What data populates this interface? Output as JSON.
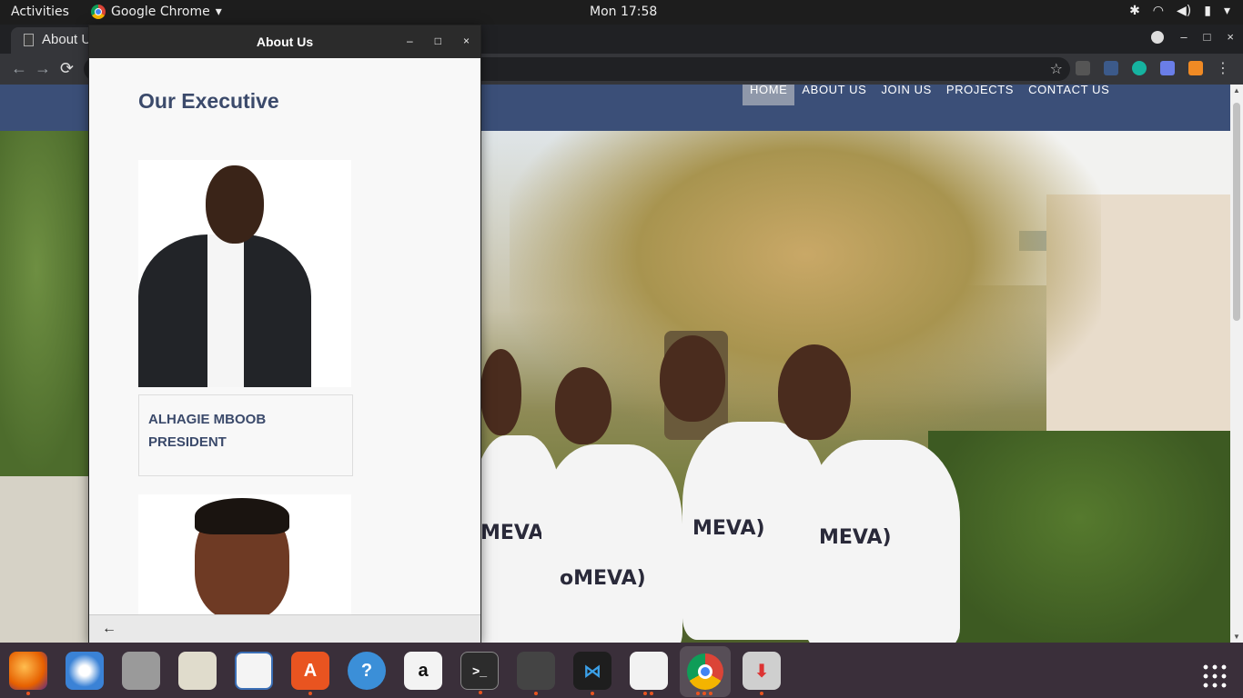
{
  "topbar": {
    "activities": "Activities",
    "app_name": "Google Chrome",
    "app_menu_arrow": "▾",
    "clock": "Mon 17:58"
  },
  "browser": {
    "tab_title": "About U",
    "win_minimize": "–",
    "win_maximize": "□",
    "win_close": "×",
    "back": "←",
    "forward": "→",
    "reload": "⟳",
    "star": "☆",
    "menu": "⋮"
  },
  "site_nav": {
    "items": [
      "HOME",
      "ABOUT US",
      "JOIN US",
      "PROJECTS",
      "CONTACT US"
    ]
  },
  "hero_shirts": [
    "MEVA",
    "oMEVA)",
    "MEVA)",
    "MEVA)"
  ],
  "popup": {
    "title": "About Us",
    "minimize": "–",
    "maximize": "□",
    "close": "×",
    "section_title": "Our Executive",
    "member1_name": "ALHAGIE MBOOB",
    "member1_role": "PRESIDENT",
    "back": "←"
  },
  "dock": {
    "items": [
      "firefox-icon",
      "thunderbird-icon",
      "files-icon",
      "rhythmbox-icon",
      "libreoffice-impress-icon",
      "software-center-icon",
      "help-icon",
      "amazon-icon",
      "terminal-icon",
      "video-editor-icon",
      "vscode-icon",
      "document-icon",
      "chrome-icon",
      "installer-icon"
    ]
  },
  "colors": {
    "nav_bg": "#3b4f78",
    "heading": "#3b4a6b",
    "dock_bg": "#3a2f3a"
  }
}
